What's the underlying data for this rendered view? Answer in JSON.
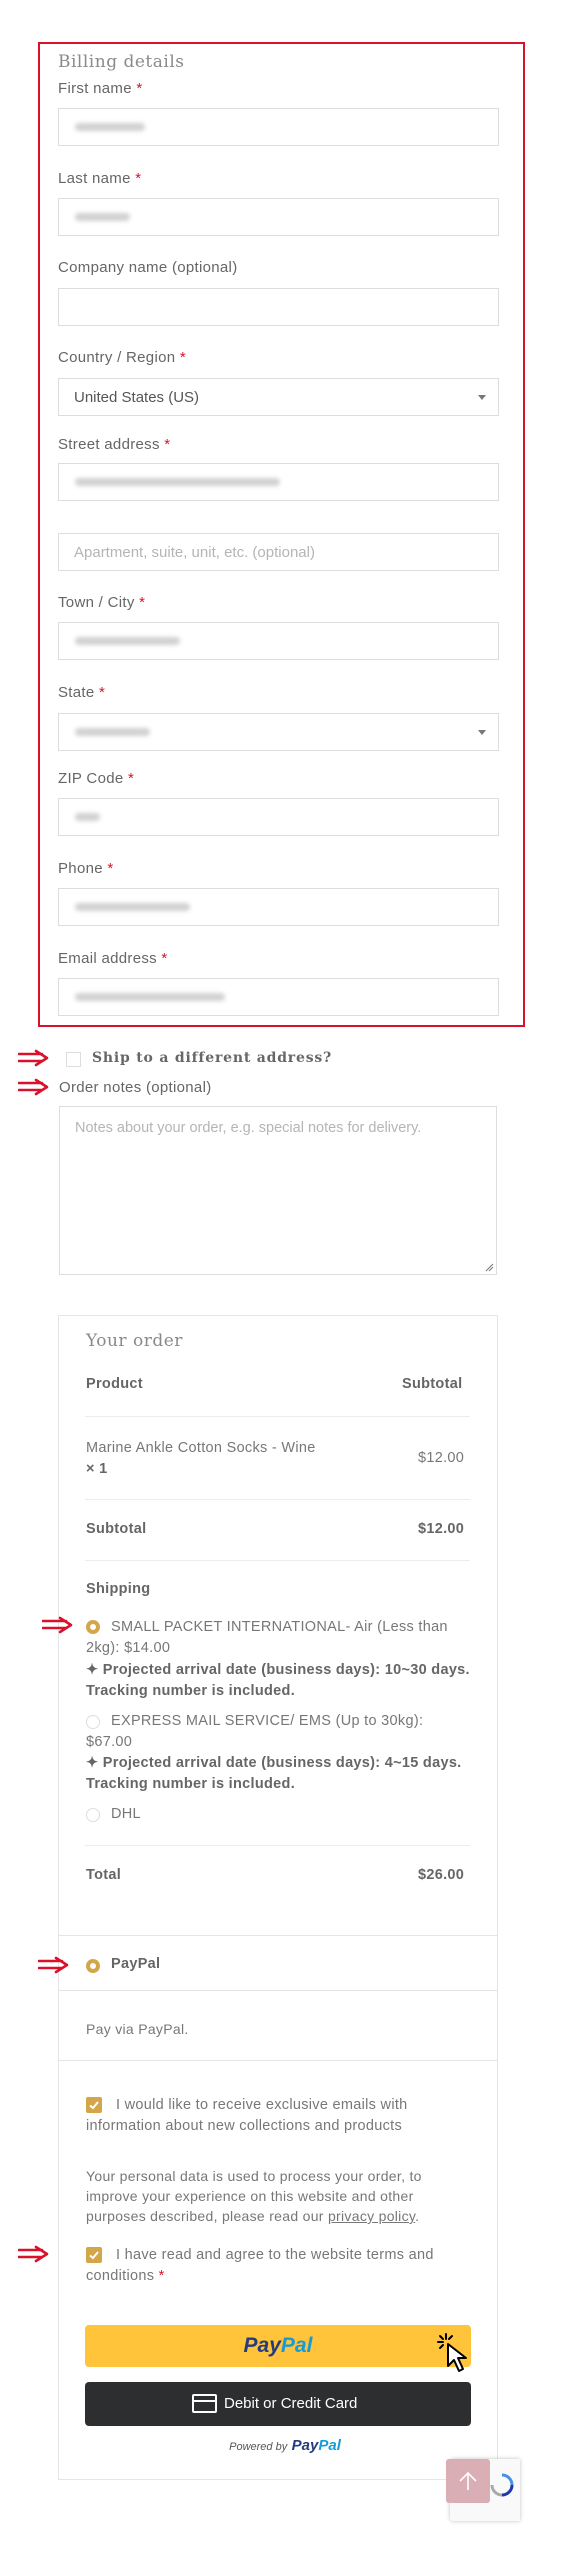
{
  "billing": {
    "title": "Billing details",
    "required_mark": "*",
    "first_name_label": "First name",
    "last_name_label": "Last name",
    "company_label": "Company name (optional)",
    "country_label": "Country / Region",
    "country_value": "United States (US)",
    "street_label": "Street address",
    "apartment_placeholder": "Apartment, suite, unit, etc. (optional)",
    "city_label": "Town / City",
    "state_label": "State",
    "zip_label": "ZIP Code",
    "phone_label": "Phone",
    "email_label": "Email address"
  },
  "ship_different": "Ship to a different address?",
  "order_notes": {
    "label": "Order notes (optional)",
    "placeholder": "Notes about your order, e.g. special notes for delivery."
  },
  "order": {
    "title": "Your order",
    "col_product": "Product",
    "col_subtotal": "Subtotal",
    "item_name": "Marine Ankle Cotton Socks - Wine",
    "item_qty": "× 1",
    "item_price": "$12.00",
    "subtotal_label": "Subtotal",
    "subtotal_value": "$12.00",
    "shipping_label": "Shipping",
    "ship_option_1": "SMALL PACKET INTERNATIONAL- Air (Less than 2kg): $14.00",
    "ship_option_1_note": "✦ Projected arrival date (business days): 10~30 days. Tracking number is included.",
    "ship_option_2": "EXPRESS MAIL SERVICE/ EMS (Up to 30kg): $67.00",
    "ship_option_2_note": "✦ Projected arrival date (business days): 4~15 days. Tracking number is included.",
    "ship_option_3": "DHL",
    "total_label": "Total",
    "total_value": "$26.00"
  },
  "payment": {
    "method": "PayPal",
    "description": "Pay via PayPal.",
    "newsletter": "I would like to receive exclusive emails with information about new collections and products",
    "privacy_text": "Your personal data is used to process your order, to improve your experience on this website and other purposes described, please read our",
    "privacy_link": "privacy policy",
    "terms": "I have read and agree to the website terms and conditions",
    "paypal_button_a": "Pay",
    "paypal_button_b": "Pal",
    "card_button": "Debit or Credit Card",
    "powered_by": "Powered by",
    "powered_brand_a": "Pay",
    "powered_brand_b": "Pal"
  },
  "colors": {
    "required": "#d9112b",
    "accent": "#d4a64a",
    "paypal_yellow": "#ffc439",
    "paypal_dark_blue": "#253b80",
    "paypal_light_blue": "#179bd7"
  }
}
